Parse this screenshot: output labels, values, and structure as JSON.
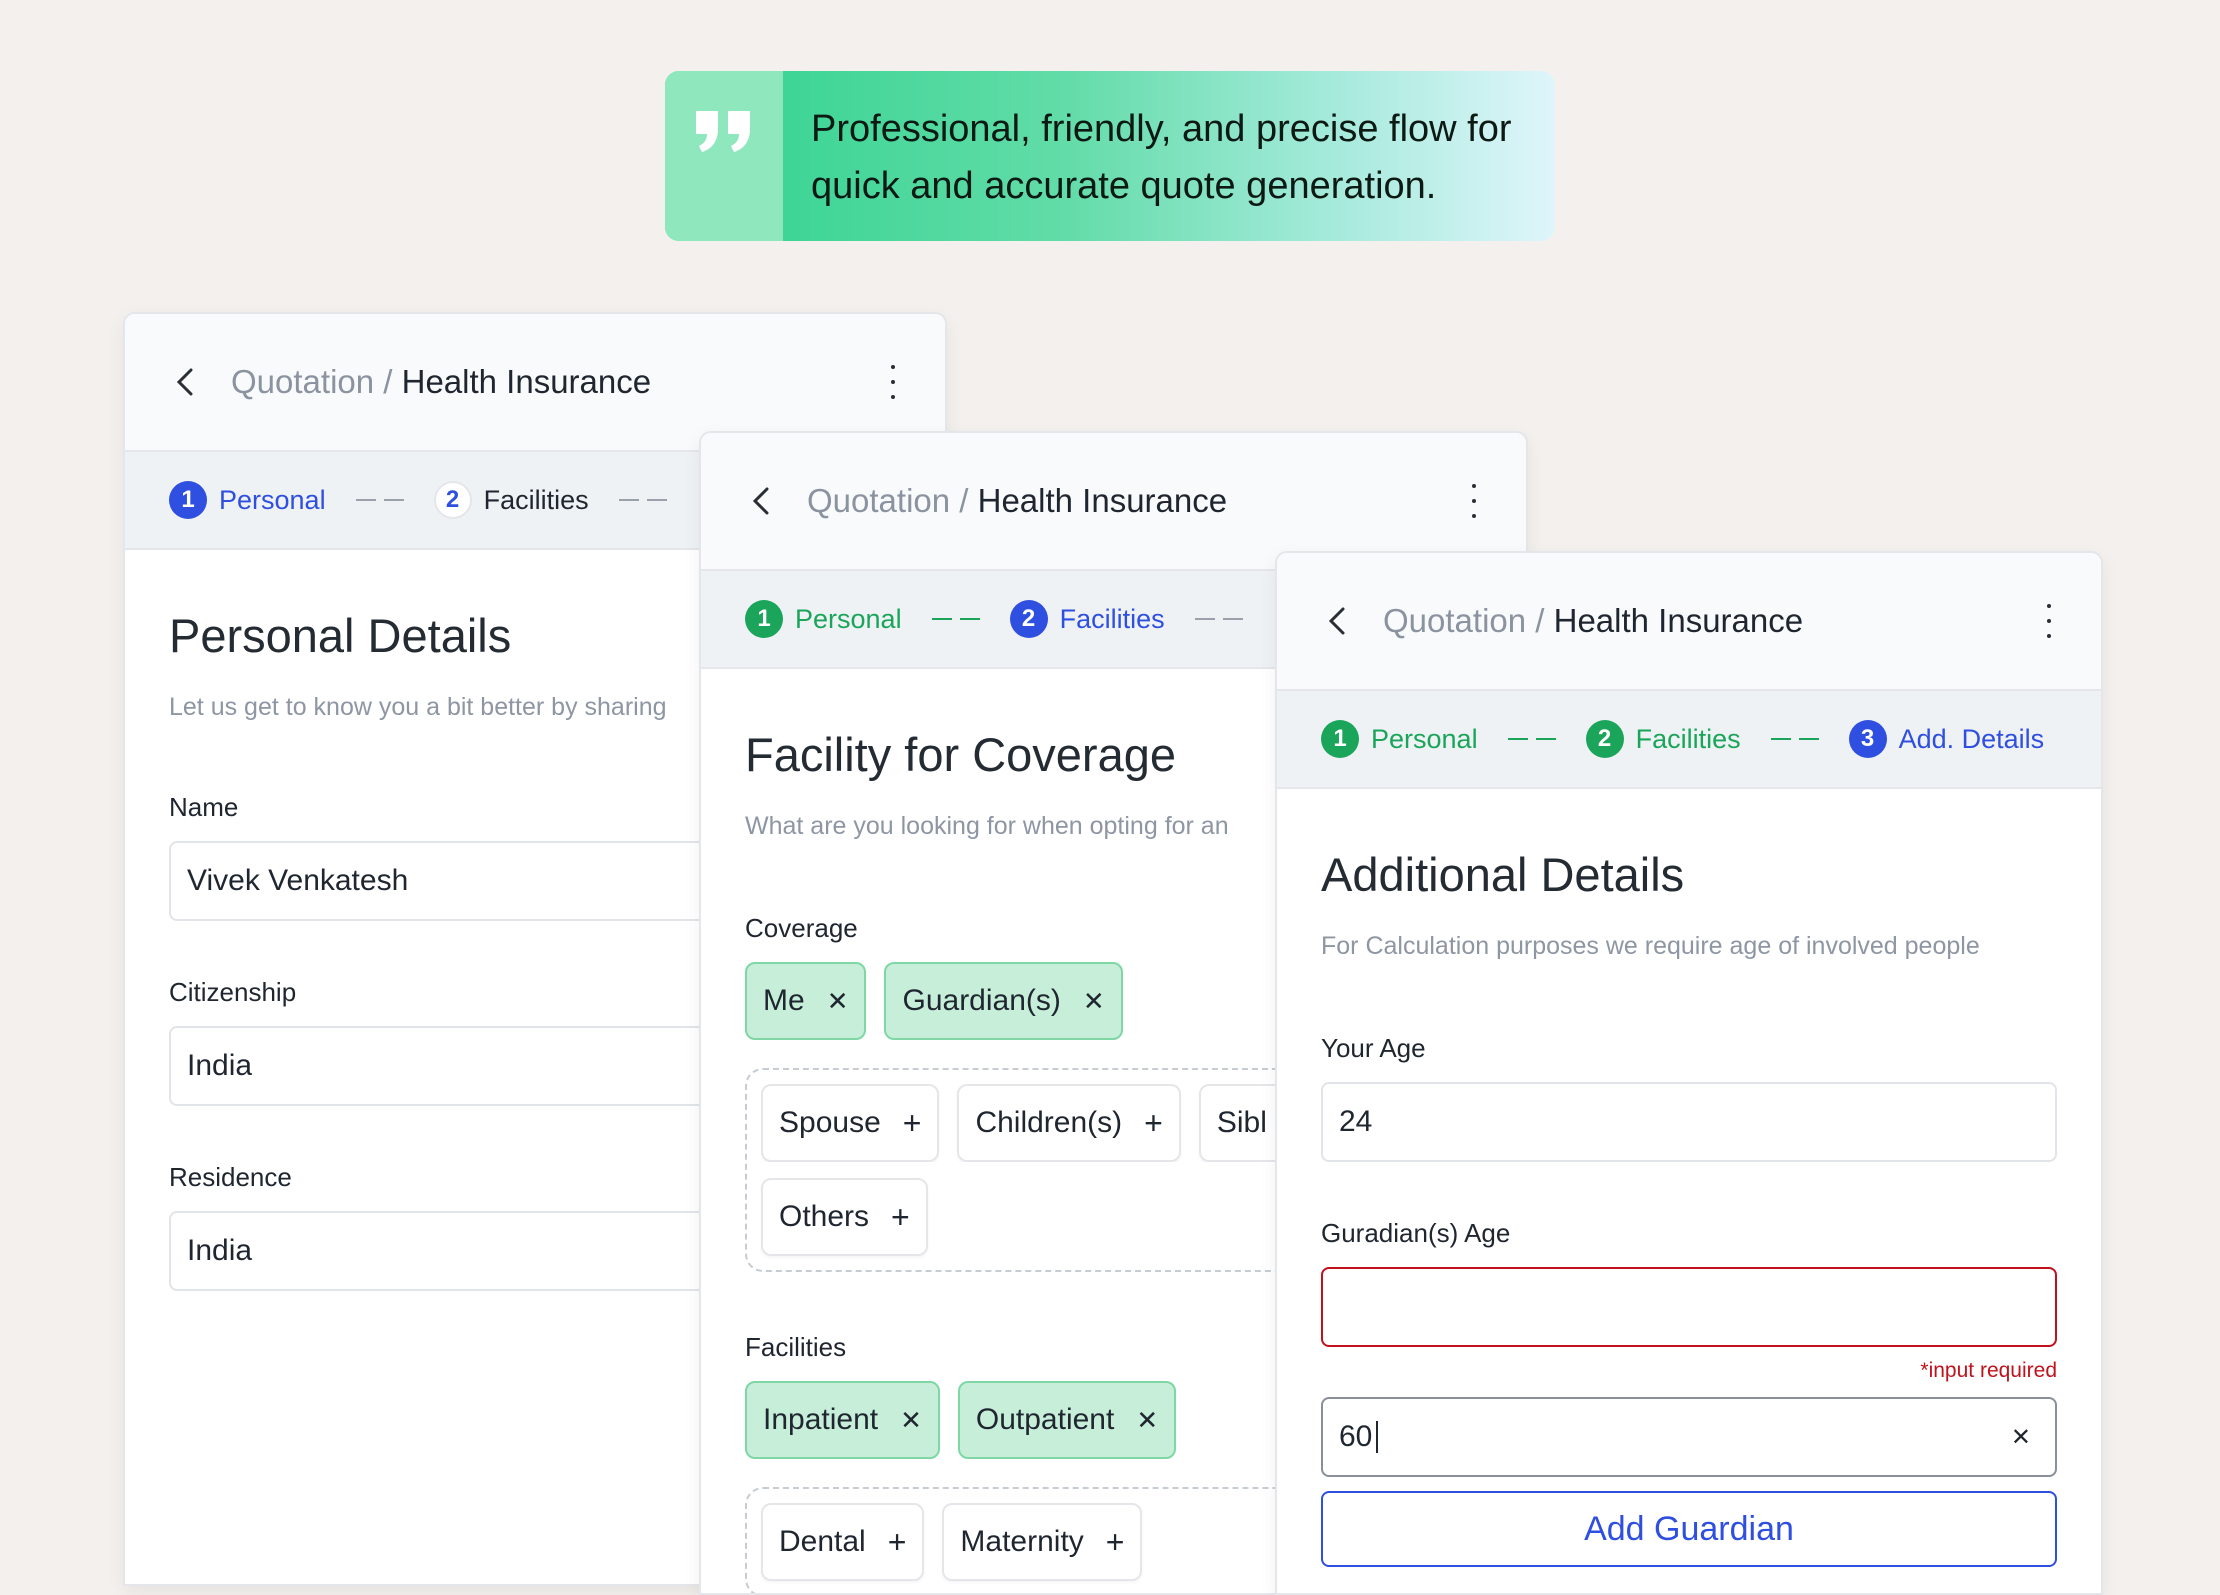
{
  "quote": {
    "text": "Professional, friendly, and precise flow for\nquick and accurate quote generation."
  },
  "breadcrumb": {
    "parent": "Quotation",
    "separator": "/",
    "current": "Health Insurance"
  },
  "steps": {
    "personal": "Personal",
    "facilities": "Facilities",
    "add_details": "Add. Details",
    "n1": "1",
    "n2": "2",
    "n3": "3"
  },
  "personal": {
    "title": "Personal Details",
    "subtitle": "Let us get to know you a bit better by sharing",
    "fields": [
      {
        "label": "Name",
        "value": "Vivek Venkatesh"
      },
      {
        "label": "Citizenship",
        "value": "India"
      },
      {
        "label": "Residence",
        "value": "India"
      }
    ]
  },
  "facility": {
    "title": "Facility for Coverage",
    "subtitle": "What are you looking for when opting for an",
    "coverage_label": "Coverage",
    "coverage_selected": [
      "Me",
      "Guardian(s)"
    ],
    "coverage_options": [
      "Spouse",
      "Children(s)",
      "Sibl",
      "Others"
    ],
    "facilities_label": "Facilities",
    "facilities_selected": [
      "Inpatient",
      "Outpatient"
    ],
    "facilities_options": [
      "Dental",
      "Maternity"
    ]
  },
  "additional": {
    "title": "Additional Details",
    "subtitle": "For Calculation purposes we require age of involved people",
    "your_age_label": "Your Age",
    "your_age_value": "24",
    "guardian_label": "Guradian(s) Age",
    "guardian_value": "",
    "error_text": "*input required",
    "second_guardian_value": "60",
    "add_button": "Add Guardian"
  },
  "colors": {
    "primary": "#2e4fe0",
    "success": "#1aa55a",
    "error": "#c0121c",
    "chip_bg": "#c6eed8"
  }
}
